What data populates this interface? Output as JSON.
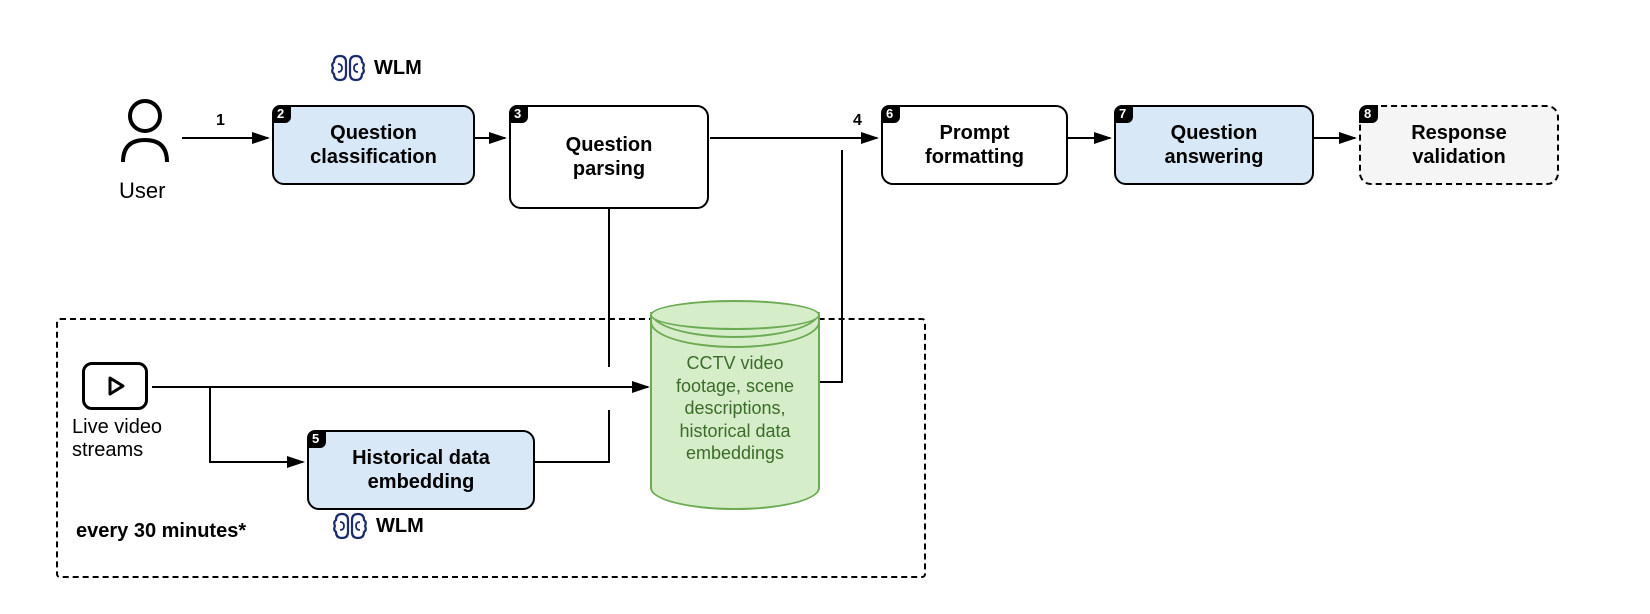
{
  "user_label": "User",
  "wlm_label_top": "WLM",
  "wlm_label_bottom": "WLM",
  "steps": {
    "s1": "1",
    "s2": {
      "num": "2",
      "label": "Question\nclassification"
    },
    "s3": {
      "num": "3",
      "label": "Question parsing"
    },
    "s4": "4",
    "s5": {
      "num": "5",
      "label": "Historical data\nembedding"
    },
    "s6": {
      "num": "6",
      "label": "Prompt\nformatting"
    },
    "s7": {
      "num": "7",
      "label": "Question\nanswering"
    },
    "s8": {
      "num": "8",
      "label": "Response\nvalidation"
    }
  },
  "video_label": "Live video\nstreams",
  "db_text": "CCTV video\nfootage, scene\ndescriptions,\nhistorical data\nembeddings",
  "frequency": "every 30 minutes*"
}
